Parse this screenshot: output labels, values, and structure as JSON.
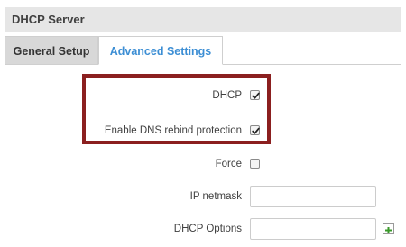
{
  "section": {
    "title": "DHCP Server"
  },
  "tabs": [
    {
      "label": "General Setup",
      "active": false
    },
    {
      "label": "Advanced Settings",
      "active": true
    }
  ],
  "fields": {
    "dhcp": {
      "label": "DHCP",
      "checked": true
    },
    "dns_rebind": {
      "label": "Enable DNS rebind protection",
      "checked": true
    },
    "force": {
      "label": "Force",
      "checked": false
    },
    "ip_netmask": {
      "label": "IP netmask",
      "value": "",
      "placeholder": ""
    },
    "dhcp_options": {
      "label": "DHCP Options",
      "value": "",
      "placeholder": ""
    }
  },
  "icons": {
    "add": "plus-icon",
    "check": "checkmark-icon"
  },
  "colors": {
    "active_tab_text": "#3c8ed4",
    "highlight_border": "#8b1f1f",
    "add_icon": "#3a9a2a"
  }
}
